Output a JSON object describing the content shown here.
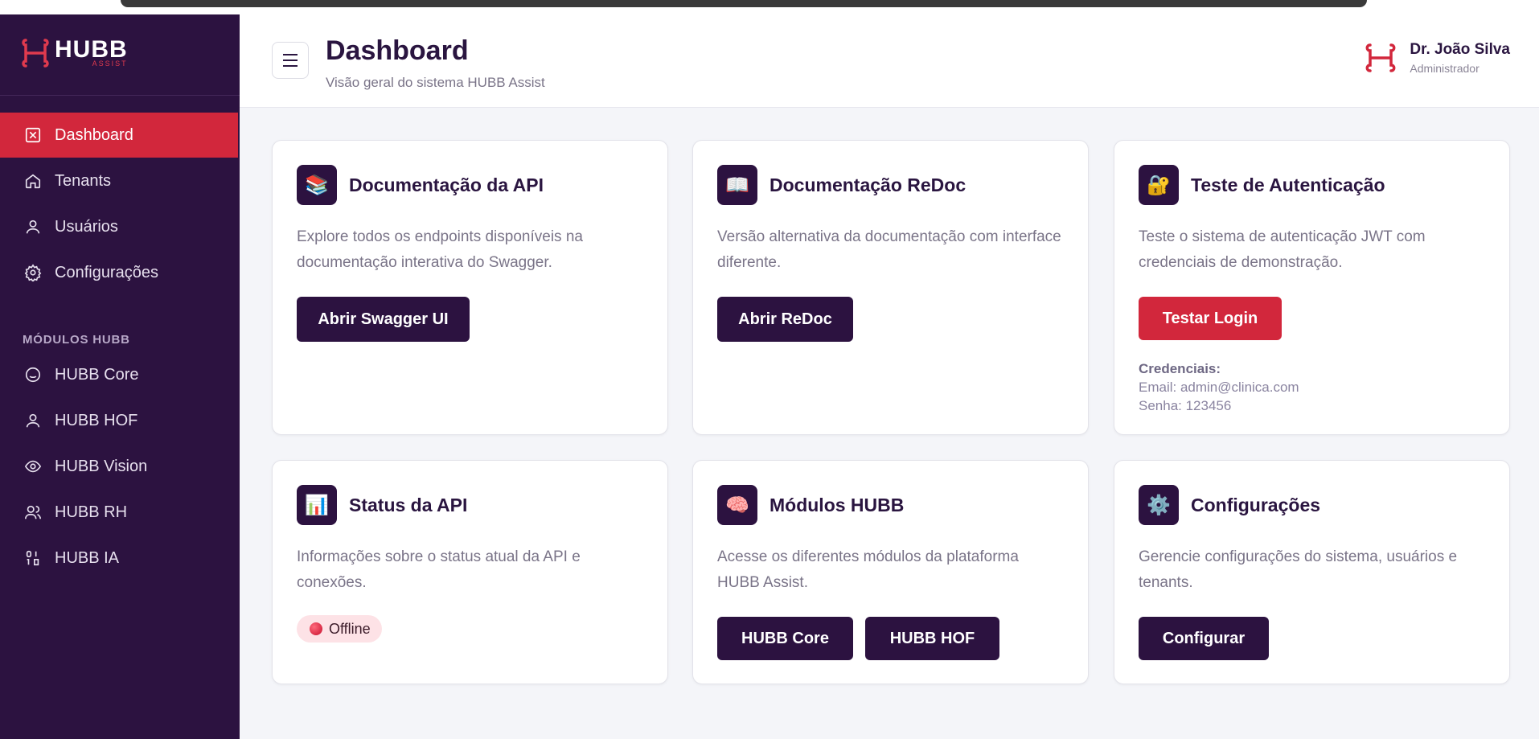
{
  "app": {
    "logo_text": "HUBB",
    "logo_sub": "ASSIST"
  },
  "sidebar": {
    "items": [
      {
        "label": "Dashboard",
        "icon": "dashboard-icon",
        "active": true
      },
      {
        "label": "Tenants",
        "icon": "home-icon"
      },
      {
        "label": "Usuários",
        "icon": "user-icon"
      },
      {
        "label": "Configurações",
        "icon": "gear-icon"
      }
    ],
    "section_label": "MÓDULOS HUBB",
    "modules": [
      {
        "label": "HUBB Core",
        "icon": "smile-icon"
      },
      {
        "label": "HUBB HOF",
        "icon": "user-icon"
      },
      {
        "label": "HUBB Vision",
        "icon": "eye-icon"
      },
      {
        "label": "HUBB RH",
        "icon": "users-icon"
      },
      {
        "label": "HUBB IA",
        "icon": "binary-icon"
      }
    ]
  },
  "header": {
    "title": "Dashboard",
    "subtitle": "Visão geral do sistema HUBB Assist",
    "user_name": "Dr. João Silva",
    "user_role": "Administrador"
  },
  "cards": {
    "api_docs": {
      "icon": "📚",
      "title": "Documentação da API",
      "desc": "Explore todos os endpoints disponíveis na documentação interativa do Swagger.",
      "button": "Abrir Swagger UI"
    },
    "redoc": {
      "icon": "📖",
      "title": "Documentação ReDoc",
      "desc": "Versão alternativa da documentação com interface diferente.",
      "button": "Abrir ReDoc"
    },
    "auth": {
      "icon": "🔐",
      "title": "Teste de Autenticação",
      "desc": "Teste o sistema de autenticação JWT com credenciais de demonstração.",
      "button": "Testar Login",
      "cred_label": "Credenciais:",
      "cred_email": "Email: admin@clinica.com",
      "cred_password": "Senha: 123456"
    },
    "status": {
      "icon": "📊",
      "title": "Status da API",
      "desc": "Informações sobre o status atual da API e conexões.",
      "badge": "Offline"
    },
    "modules": {
      "icon": "🧠",
      "title": "Módulos HUBB",
      "desc": "Acesse os diferentes módulos da plataforma HUBB Assist.",
      "button_core": "HUBB Core",
      "button_hof": "HUBB HOF"
    },
    "settings": {
      "icon": "⚙️",
      "title": "Configurações",
      "desc": "Gerencie configurações do sistema, usuários e tenants.",
      "button": "Configurar"
    }
  },
  "colors": {
    "sidebar": "#2c1240",
    "accent": "#d2273c",
    "primary_button": "#2c1240"
  }
}
